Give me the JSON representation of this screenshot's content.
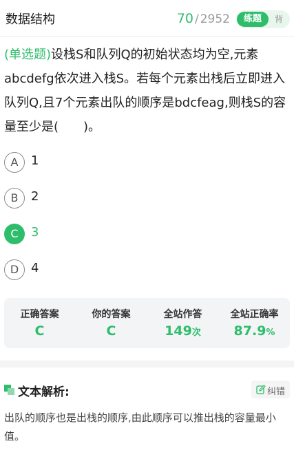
{
  "header": {
    "title": "数据结构",
    "progress_current": "70",
    "progress_separator": "/",
    "progress_total": "2952",
    "mode_active": "练题",
    "mode_inactive": "背"
  },
  "question": {
    "type_label": "(单选题)",
    "text": "设栈S和队列Q的初始状态均为空,元素abcdefg依次进入栈S。若每个元素出栈后立即进入队列Q,且7个元素出队的顺序是bdcfeag,则栈S的容量至少是(　　)。"
  },
  "options": [
    {
      "letter": "A",
      "text": "1"
    },
    {
      "letter": "B",
      "text": "2"
    },
    {
      "letter": "C",
      "text": "3",
      "selected": true
    },
    {
      "letter": "D",
      "text": "4"
    }
  ],
  "stats": {
    "correct_answer_label": "正确答案",
    "correct_answer": "C",
    "your_answer_label": "你的答案",
    "your_answer": "C",
    "attempts_label": "全站作答",
    "attempts_value": "149",
    "attempts_unit": "次",
    "accuracy_label": "全站正确率",
    "accuracy_value": "87.9",
    "accuracy_unit": "%"
  },
  "analysis": {
    "title": "文本解析:",
    "report_label": "纠错",
    "text": "出队的顺序也是出栈的顺序,由此顺序可以推出栈的容量最小值。"
  },
  "colors": {
    "accent": "#2ebd6b",
    "accent_light": "#e8f7ee"
  }
}
